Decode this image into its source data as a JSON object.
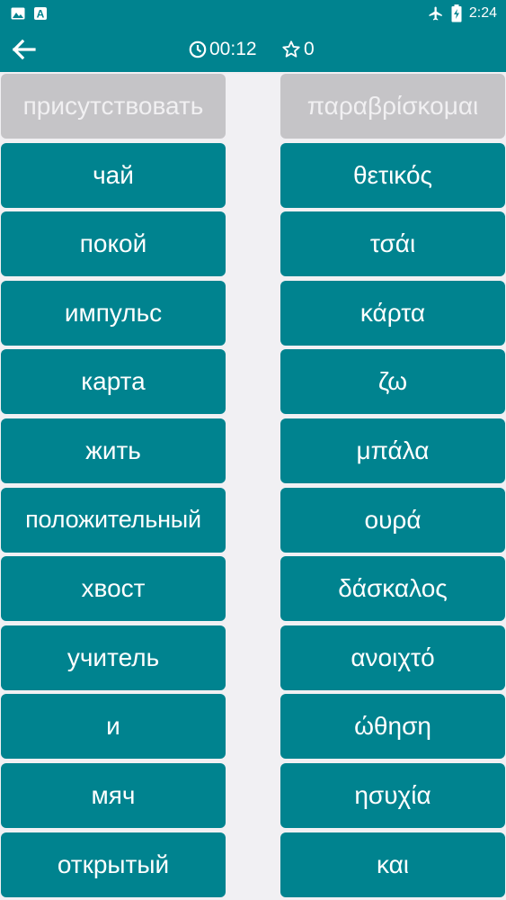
{
  "colors": {
    "primary": "#00838f",
    "tile_matched": "#c5c4c7",
    "background": "#f1f0f3"
  },
  "status_bar": {
    "time": "2:24",
    "icons": [
      "image-icon",
      "app-a-icon",
      "airplane-icon",
      "battery-charging-icon"
    ]
  },
  "toolbar": {
    "back_icon": "arrow-left-icon",
    "timer_icon": "clock-icon",
    "timer": "00:12",
    "score_icon": "star-outline-icon",
    "score": "0"
  },
  "left_column": [
    {
      "label": "присутствовать",
      "state": "matched"
    },
    {
      "label": "чай",
      "state": "active"
    },
    {
      "label": "покой",
      "state": "active"
    },
    {
      "label": "импульс",
      "state": "active"
    },
    {
      "label": "карта",
      "state": "active"
    },
    {
      "label": "жить",
      "state": "active"
    },
    {
      "label": "положительный",
      "state": "active"
    },
    {
      "label": "хвост",
      "state": "active"
    },
    {
      "label": "учитель",
      "state": "active"
    },
    {
      "label": "и",
      "state": "active"
    },
    {
      "label": "мяч",
      "state": "active"
    },
    {
      "label": "открытый",
      "state": "active"
    }
  ],
  "right_column": [
    {
      "label": "παραβρίσκομαι",
      "state": "matched"
    },
    {
      "label": "θετικός",
      "state": "active"
    },
    {
      "label": "τσάι",
      "state": "active"
    },
    {
      "label": "κάρτα",
      "state": "active"
    },
    {
      "label": "ζω",
      "state": "active"
    },
    {
      "label": "μπάλα",
      "state": "active"
    },
    {
      "label": "ουρά",
      "state": "active"
    },
    {
      "label": "δάσκαλος",
      "state": "active"
    },
    {
      "label": "ανοιχτό",
      "state": "active"
    },
    {
      "label": "ώθηση",
      "state": "active"
    },
    {
      "label": "ησυχία",
      "state": "active"
    },
    {
      "label": "και",
      "state": "active"
    }
  ]
}
